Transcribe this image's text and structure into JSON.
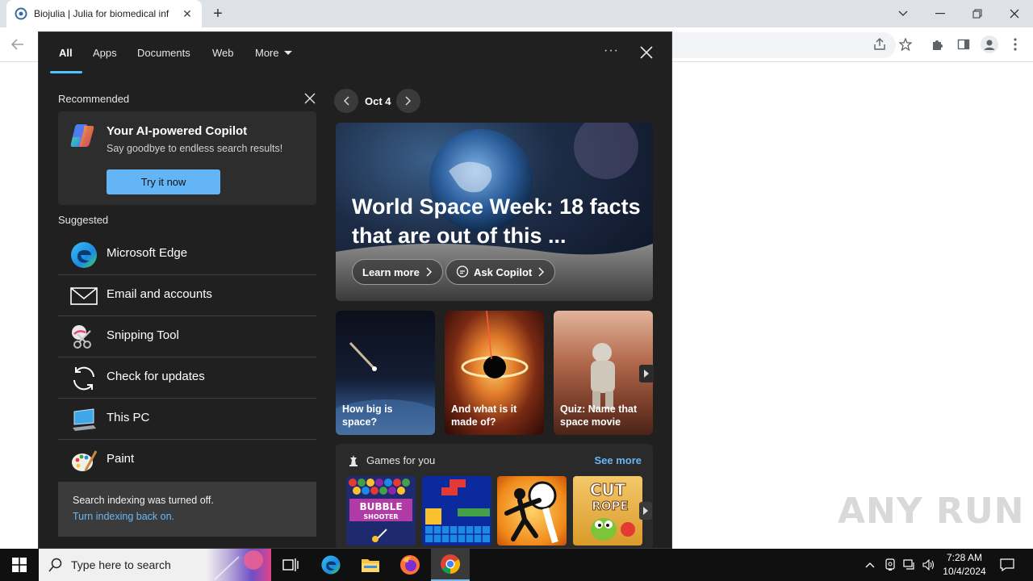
{
  "browser": {
    "tab_title": "Biojulia | Julia for biomedical inf",
    "new_tab_symbol": "+",
    "window_controls": [
      "chevron-down-icon",
      "minimize-icon",
      "restore-icon",
      "close-icon"
    ]
  },
  "search_panel": {
    "tabs": [
      {
        "label": "All",
        "active": true
      },
      {
        "label": "Apps"
      },
      {
        "label": "Documents"
      },
      {
        "label": "Web"
      },
      {
        "label": "More"
      }
    ],
    "options_symbol": "···",
    "recommended": {
      "heading": "Recommended",
      "card_title": "Your AI-powered Copilot",
      "card_subtitle": "Say goodbye to endless search results!",
      "button_label": "Try it now"
    },
    "suggested": {
      "heading": "Suggested",
      "apps": [
        {
          "label": "Microsoft Edge",
          "icon": "edge-icon"
        },
        {
          "label": "Email and accounts",
          "icon": "mail-icon"
        },
        {
          "label": "Snipping Tool",
          "icon": "snipping-tool-icon"
        },
        {
          "label": "Check for updates",
          "icon": "refresh-icon"
        },
        {
          "label": "This PC",
          "icon": "computer-icon"
        },
        {
          "label": "Paint",
          "icon": "paint-icon"
        }
      ]
    },
    "indexing": {
      "message": "Search indexing was turned off.",
      "link": "Turn indexing back on."
    },
    "highlights": {
      "date": "Oct 4",
      "hero_title": "World Space Week: 18 facts that are out of this ...",
      "learn_more": "Learn more",
      "ask_copilot": "Ask Copilot",
      "tiles": [
        {
          "caption": "How big is space?"
        },
        {
          "caption": "And what is it made of?"
        },
        {
          "caption": "Quiz: Name that space movie"
        }
      ]
    },
    "games": {
      "heading": "Games for you",
      "see_more": "See more",
      "items": [
        "Bubble Shooter HD",
        "Block puzzle",
        "Stickman fighter",
        "Cut the Rope"
      ],
      "bubble_label": "BUBBLE",
      "shooter_label": "SHOOTER",
      "cut_label": "CUT",
      "rope_label": "ROPE"
    }
  },
  "taskbar": {
    "search_placeholder": "Type here to search",
    "time": "7:28 AM",
    "date": "10/4/2024"
  },
  "watermark": "ANY RUN",
  "colors": {
    "accent_blue": "#64b5f6",
    "link_blue": "#6ab7f5",
    "panel_bg": "#202020",
    "taskbar_bg": "#101010"
  }
}
